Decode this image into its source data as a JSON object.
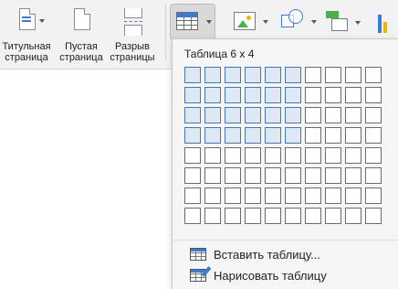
{
  "ribbon": {
    "buttons": [
      {
        "id": "title-page",
        "label_line1": "Титульная",
        "label_line2": "страница"
      },
      {
        "id": "blank-page",
        "label_line1": "Пустая",
        "label_line2": "страница"
      },
      {
        "id": "page-break",
        "label_line1": "Разрыв",
        "label_line2": "страницы"
      }
    ],
    "icons": [
      "table-icon",
      "picture-icon",
      "shapes-icon",
      "smartart-icon",
      "chart-icon"
    ]
  },
  "table_menu": {
    "title": "Таблица 6 х 4",
    "grid": {
      "columns": 10,
      "rows": 8,
      "selected_columns": 6,
      "selected_rows": 4
    },
    "items": [
      {
        "label": "Вставить таблицу...",
        "icon": "insert-table-icon"
      },
      {
        "label": "Нарисовать таблицу",
        "icon": "draw-table-icon"
      }
    ]
  },
  "colors": {
    "accent": "#3b7bd4",
    "selected_cell": "#dde8f4",
    "menu_bg": "#f5f5f5"
  }
}
